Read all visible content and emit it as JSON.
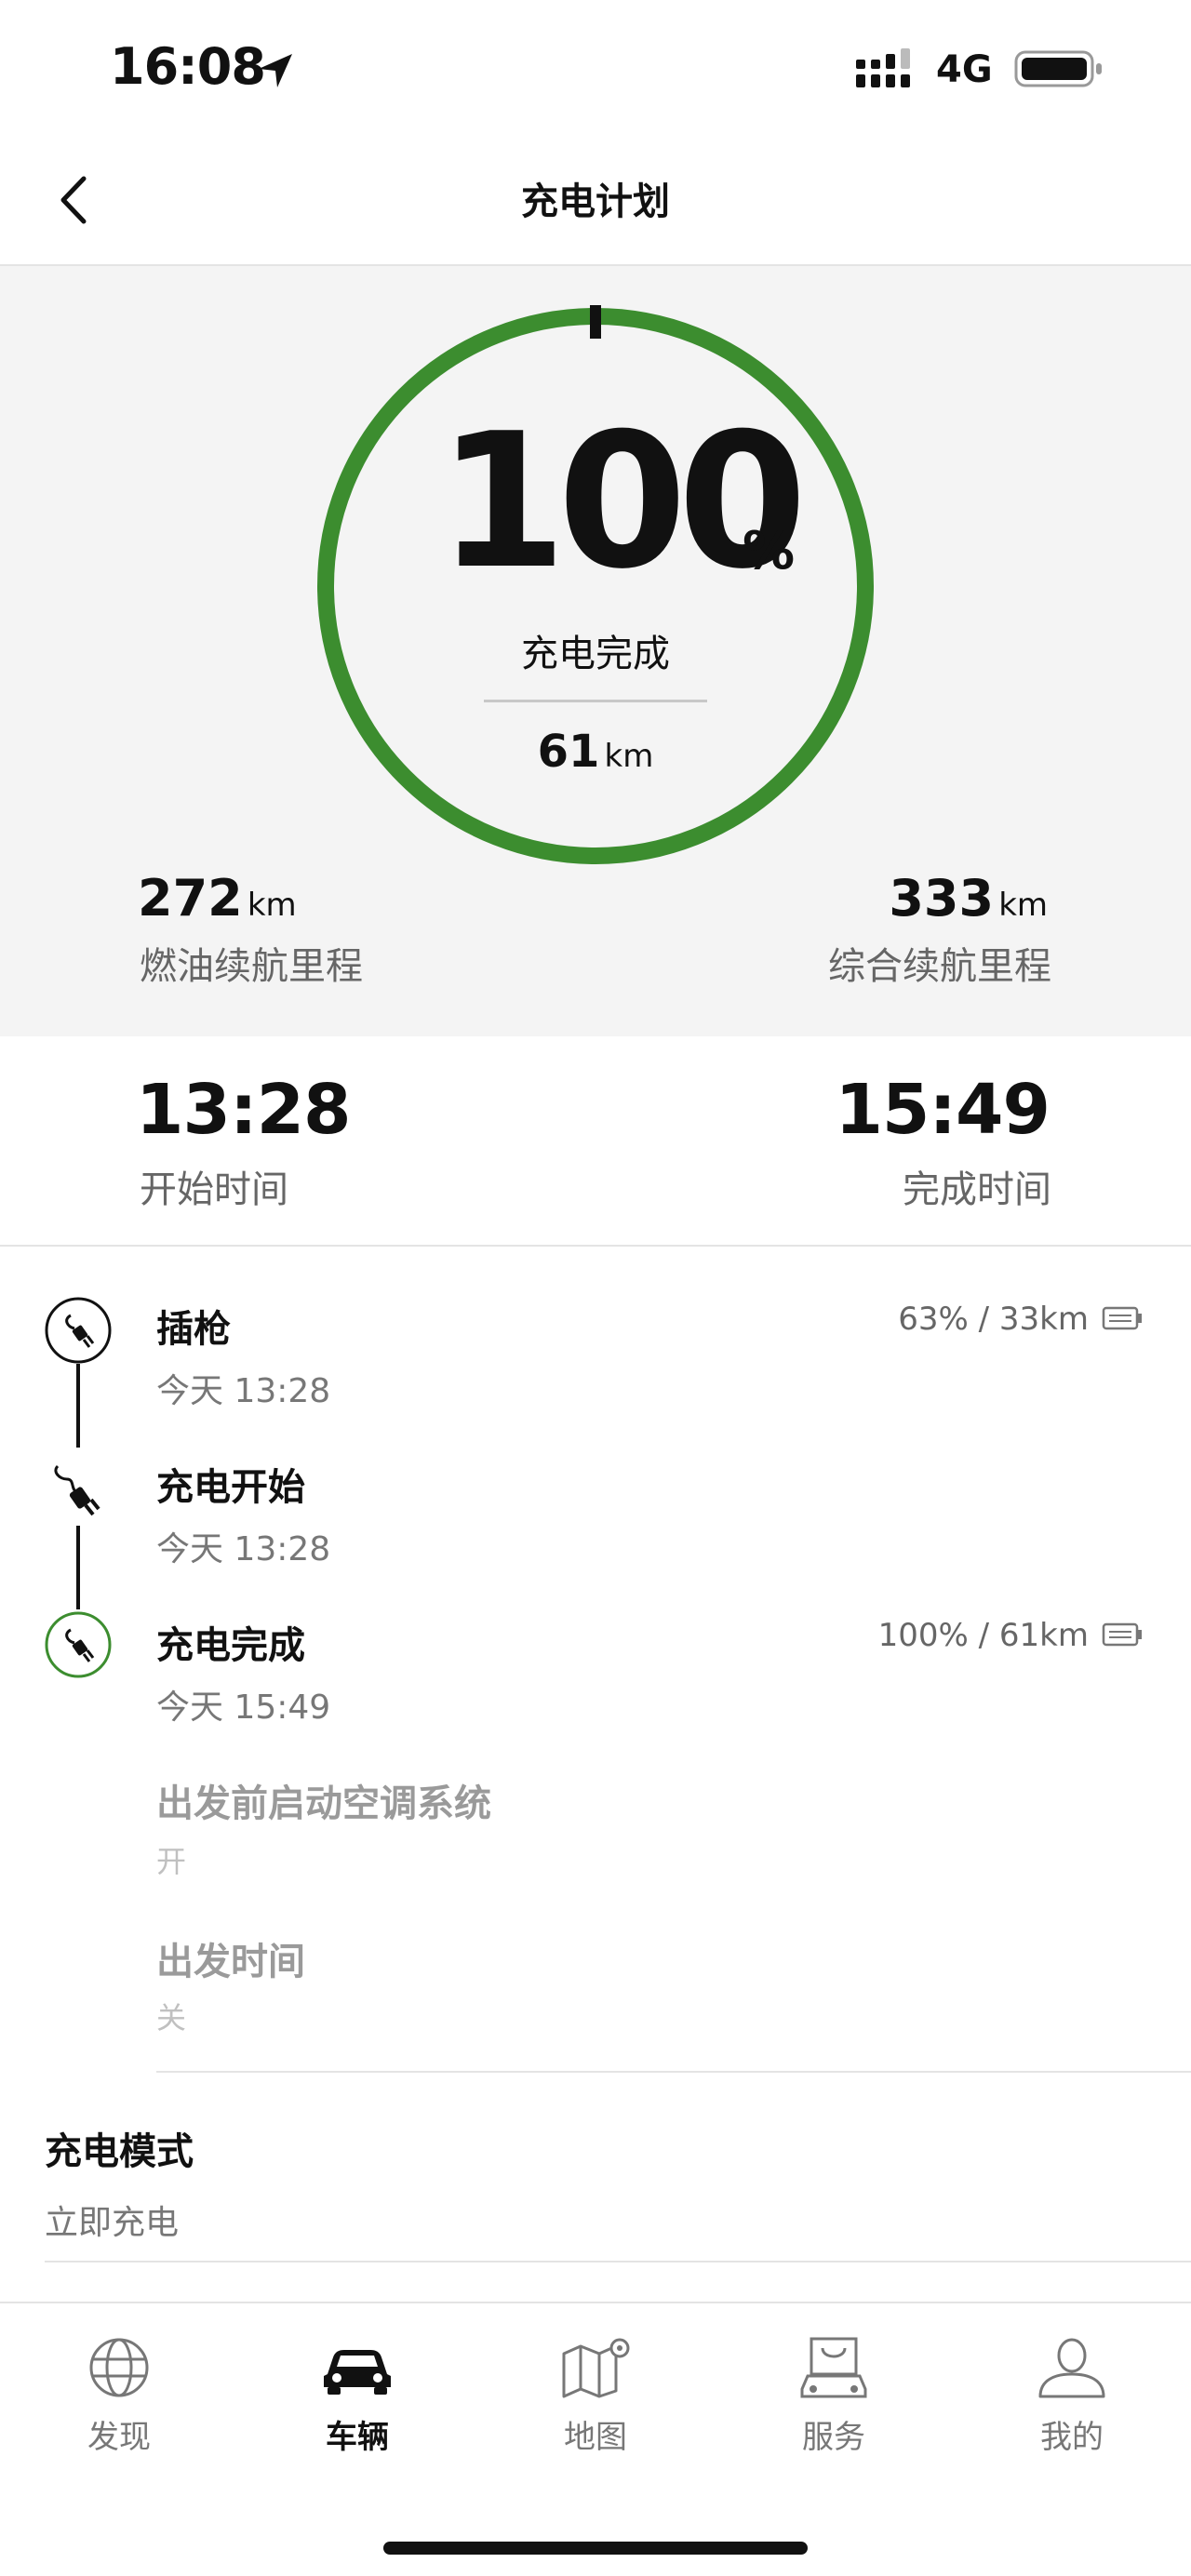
{
  "status_bar": {
    "time": "16:08",
    "network": "4G"
  },
  "header": {
    "title": "充电计划"
  },
  "charge": {
    "percent": "100",
    "percent_unit": "%",
    "percent_value": 100,
    "status": "充电完成",
    "ev_range_value": "61",
    "ev_range_unit": "km",
    "fuel_range_value": "272",
    "fuel_range_unit": "km",
    "fuel_range_label": "燃油续航里程",
    "total_range_value": "333",
    "total_range_unit": "km",
    "total_range_label": "综合续航里程",
    "ring_color": "#3c8d2f"
  },
  "times": {
    "start_time": "13:28",
    "start_label": "开始时间",
    "end_time": "15:49",
    "end_label": "完成时间"
  },
  "timeline": [
    {
      "title": "插枪",
      "subtitle": "今天 13:28",
      "right": "63% / 33km"
    },
    {
      "title": "充电开始",
      "subtitle": "今天 13:28",
      "right": ""
    },
    {
      "title": "充电完成",
      "subtitle": "今天 15:49",
      "right": "100% / 61km"
    }
  ],
  "options": [
    {
      "title": "出发前启动空调系统",
      "value": "开"
    },
    {
      "title": "出发时间",
      "value": "关"
    }
  ],
  "charge_mode": {
    "title": "充电模式",
    "value": "立即充电"
  },
  "tabbar": [
    {
      "label": "发现",
      "icon": "globe-icon",
      "active": false
    },
    {
      "label": "车辆",
      "icon": "car-icon",
      "active": true
    },
    {
      "label": "地图",
      "icon": "map-icon",
      "active": false
    },
    {
      "label": "服务",
      "icon": "shopping-bag-car-icon",
      "active": false
    },
    {
      "label": "我的",
      "icon": "person-icon",
      "active": false
    }
  ]
}
